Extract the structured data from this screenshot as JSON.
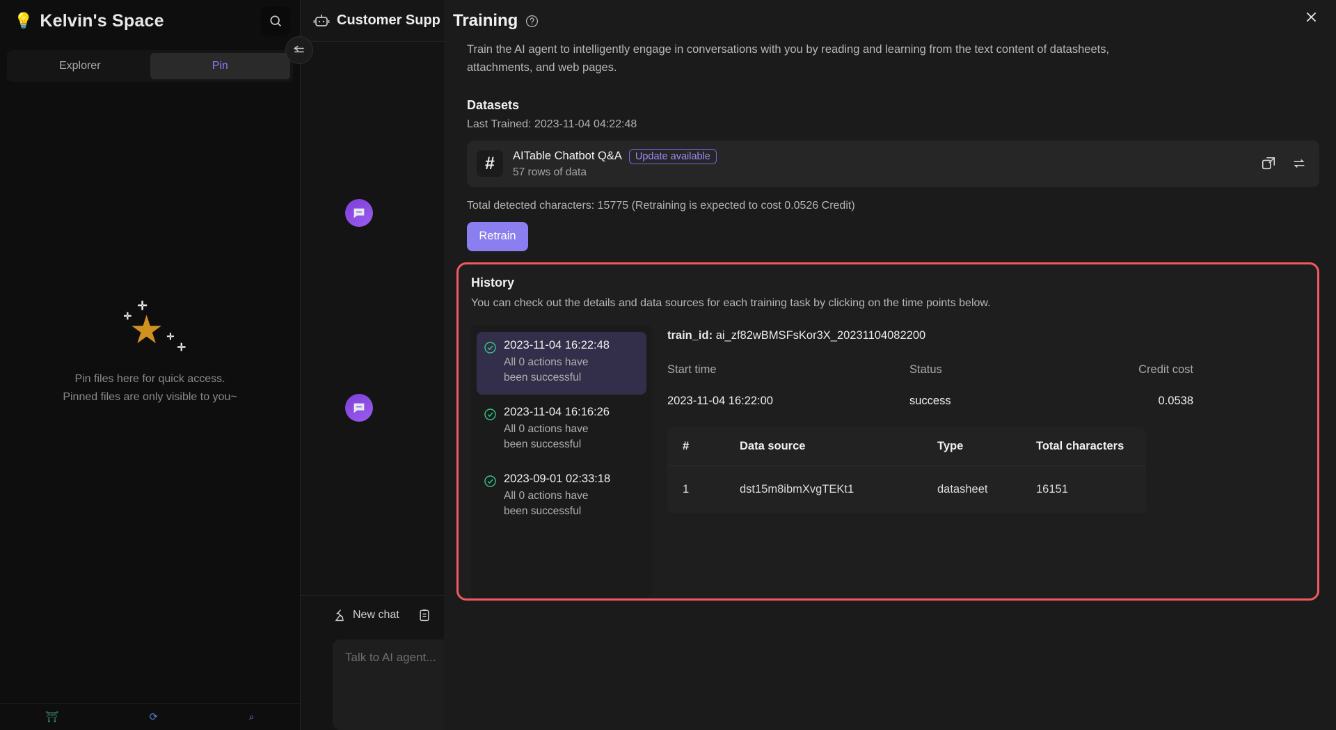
{
  "sidebar": {
    "logo_icon": "lightbulb-icon",
    "title": "Kelvin's Space",
    "search_icon": "search-icon",
    "tabs": [
      {
        "label": "Explorer",
        "active": false
      },
      {
        "label": "Pin",
        "active": true
      }
    ],
    "empty_state": {
      "star_icon": "star-icon",
      "line1": "Pin files here for quick access.",
      "line2": "Pinned files are only visible to you~"
    },
    "footer_icons": [
      "template-icon",
      "refresh-icon",
      "search-circle-icon"
    ]
  },
  "collapse_button_icon": "collapse-sidebar-icon",
  "chat": {
    "bot_icon": "robot-icon",
    "title": "Customer Supp",
    "new_chat_label": "New chat",
    "new_chat_icon": "broom-icon",
    "notes_icon": "clipboard-icon",
    "input_placeholder": "Talk to AI agent...",
    "avatar_icon": "chat-bubble-icon"
  },
  "modal": {
    "title": "Training",
    "help_icon": "question-circle-icon",
    "close_icon": "close-icon",
    "intro": "Train the AI agent to intelligently engage in conversations with you by reading and learning from the text content of datasheets, attachments, and web pages.",
    "datasets": {
      "heading": "Datasets",
      "last_trained": "Last Trained: 2023-11-04 04:22:48",
      "item": {
        "icon": "hash-grid-icon",
        "name": "AITable Chatbot Q&A",
        "badge": "Update available",
        "subtitle": "57 rows of data",
        "open_icon": "open-external-icon",
        "sync_icon": "sync-icon"
      },
      "total_line": "Total detected characters: 15775 (Retraining is expected to cost 0.0526 Credit)",
      "retrain_label": "Retrain"
    },
    "history": {
      "heading": "History",
      "subtitle": "You can check out the details and data sources for each training task by clicking on the time points below.",
      "highlight_color": "#f4595e",
      "items": [
        {
          "time": "2023-11-04 16:22:48",
          "desc": "All 0 actions have been successful",
          "status_icon": "check-circle-icon",
          "active": true
        },
        {
          "time": "2023-11-04 16:16:26",
          "desc": "All 0 actions have been successful",
          "status_icon": "check-circle-icon",
          "active": false
        },
        {
          "time": "2023-09-01 02:33:18",
          "desc": "All 0 actions have been successful",
          "status_icon": "check-circle-icon",
          "active": false
        }
      ],
      "detail": {
        "train_id_label": "train_id:",
        "train_id_value": "ai_zf82wBMSFsKor3X_20231104082200",
        "start_time_label": "Start time",
        "start_time_value": "2023-11-04 16:22:00",
        "status_label": "Status",
        "status_value": "success",
        "credit_label": "Credit cost",
        "credit_value": "0.0538",
        "table": {
          "headers": [
            "#",
            "Data source",
            "Type",
            "Total characters"
          ],
          "rows": [
            {
              "index": "1",
              "source": "dst15m8ibmXvgTEKt1",
              "type": "datasheet",
              "chars": "16151"
            }
          ]
        }
      }
    }
  }
}
